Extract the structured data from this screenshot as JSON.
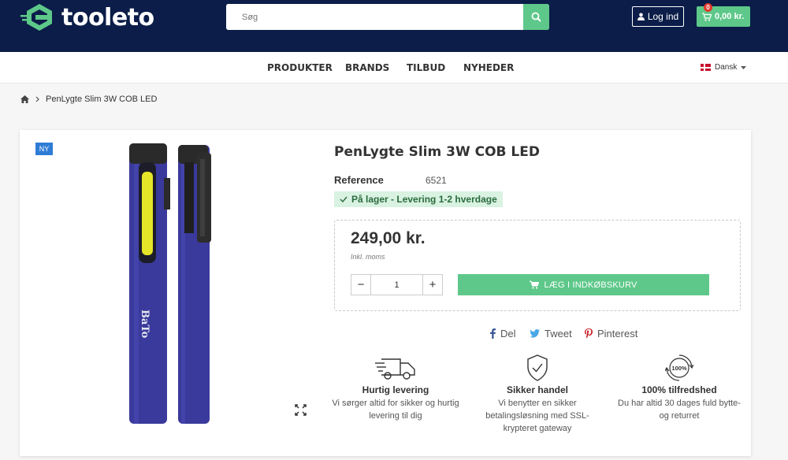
{
  "header": {
    "logo_text": "tooleto",
    "search_placeholder": "Søg",
    "login_label": "Log ind",
    "cart_count": "0",
    "cart_total": "0,00 kr.",
    "brand_color": "#0b1d48",
    "accent_color": "#5ec88a"
  },
  "nav": {
    "items": [
      "PRODUKTER",
      "BRANDS",
      "TILBUD",
      "NYHEDER"
    ],
    "language": "Dansk"
  },
  "breadcrumb": {
    "current": "PenLygte Slim 3W COB LED"
  },
  "product": {
    "badge": "NY",
    "title": "PenLygte Slim 3W COB LED",
    "reference_label": "Reference",
    "reference_value": "6521",
    "stock_text": "På lager - Levering 1-2 hverdage",
    "price": "249,00 kr.",
    "price_note": "Inkl. moms",
    "quantity": "1",
    "add_to_cart_label": "LÆG I INDKØBSKURV",
    "image_brand_text": "BaTo"
  },
  "share": {
    "facebook": "Del",
    "twitter": "Tweet",
    "pinterest": "Pinterest"
  },
  "features": [
    {
      "icon": "delivery-truck-icon",
      "title": "Hurtig levering",
      "desc": "Vi sørger altid for sikker og hurtig levering til dig"
    },
    {
      "icon": "shield-check-icon",
      "title": "Sikker handel",
      "desc": "Vi benytter en sikker betalingsløsning med SSL-krypteret gateway"
    },
    {
      "icon": "satisfaction-badge-icon",
      "badge_text": "100%",
      "title": "100% tilfredshed",
      "desc": "Du har altid 30 dages fuld bytte- og returret"
    }
  ]
}
